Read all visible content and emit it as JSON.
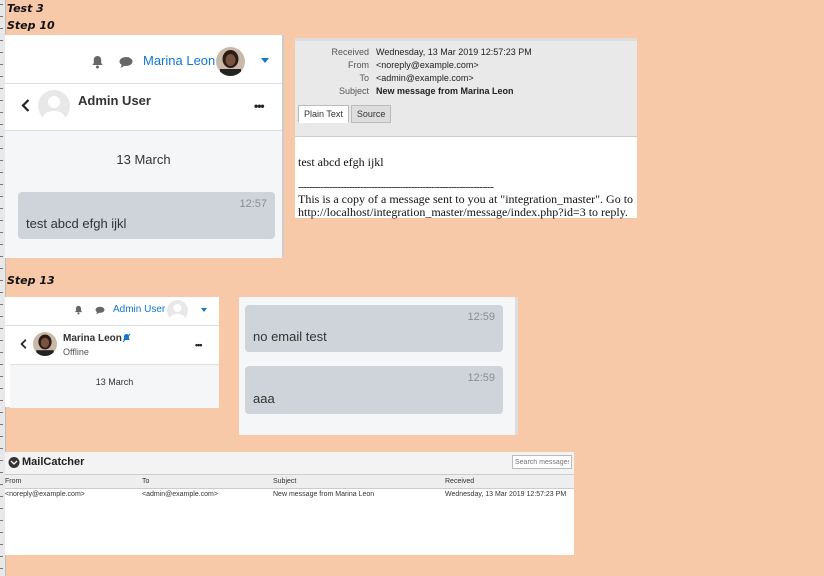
{
  "labels": {
    "test": "Test 3",
    "step10": "Step 10",
    "step13": "Step 13"
  },
  "step10_chat": {
    "user_name": "Marina Leon",
    "conversation_title": "Admin User",
    "date": "13 March",
    "messages": [
      {
        "time": "12:57",
        "text": "test abcd efgh ijkl"
      }
    ]
  },
  "email_preview": {
    "headers": [
      {
        "key": "Received",
        "value": "Wednesday, 13 Mar 2019 12:57:23 PM"
      },
      {
        "key": "From",
        "value": "<noreply@example.com>"
      },
      {
        "key": "To",
        "value": "<admin@example.com>"
      },
      {
        "key": "Subject",
        "value": "New message from Marina Leon"
      }
    ],
    "tabs": [
      "Plain Text",
      "Source"
    ],
    "body_line1": "test abcd efgh ijkl",
    "separator": "---------------------------------------------------------------------",
    "body_line2": "This is a copy of a message sent to you at \"integration_master\". Go to http://localhost/integration_master/message/index.php?id=3 to reply."
  },
  "step13_chat": {
    "user_name": "Admin User",
    "conversation_title": "Marina Leon",
    "status": "Offline",
    "date": "13 March"
  },
  "step13_messages": [
    {
      "time": "12:59",
      "text": "no email test"
    },
    {
      "time": "12:59",
      "text": "aaa"
    }
  ],
  "mailcatcher": {
    "title": "MailCatcher",
    "search_placeholder": "Search messages...",
    "columns": [
      "From",
      "To",
      "Subject",
      "Received"
    ],
    "rows": [
      {
        "from": "<noreply@example.com>",
        "to": "<admin@example.com>",
        "subject": "New message from Marina Leon",
        "received": "Wednesday, 13 Mar 2019 12:57:23 PM"
      }
    ]
  },
  "colors": {
    "background": "#f7c9a9",
    "link": "#1177d1",
    "bubble": "#ced4da"
  }
}
